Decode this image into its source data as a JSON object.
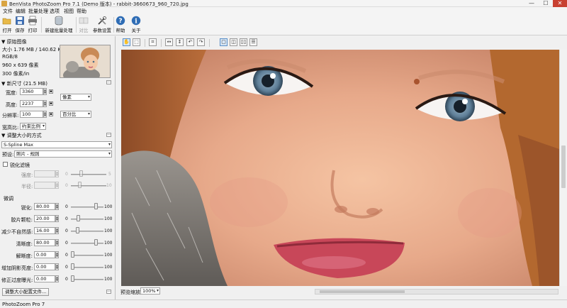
{
  "window": {
    "title": "BenVista PhotoZoom Pro 7.1 (Demo 版本) - rabbit-3660673_960_720.jpg",
    "minimize": "—",
    "maximize": "☐",
    "close": "✕"
  },
  "menu": [
    "文件",
    "编辑",
    "批量处理",
    "选项",
    "视图",
    "帮助"
  ],
  "toolbar": {
    "open": "打开",
    "save": "保存",
    "print": "打印",
    "batch": "新建批量处理",
    "batch_icon_label": "批量",
    "compare": "对比",
    "params": "参数设置",
    "help": "帮助",
    "about": "关于"
  },
  "original": {
    "section": "▼ 原始图像",
    "size": "大小 1.76 MB / 140.62 KB",
    "mode": "RGB/8",
    "dimensions": "960 x 639 像素",
    "resolution": "300 像素/in"
  },
  "new_size": {
    "section": "▼ 新尺寸 (21.5 MB)",
    "width_label": "宽度:",
    "width_value": "3360",
    "height_label": "高度:",
    "height_value": "2237",
    "resolution_label": "分辨率:",
    "resolution_value": "100",
    "unit": "像素",
    "res_unit": "百分比",
    "aspect_label": "宽高比:",
    "aspect_value": "约束比例"
  },
  "resize_method": {
    "section": "▼ 调整大小的方式",
    "method": "S-Spline Max",
    "preset_label": "预设:",
    "preset_value": "照片 - 规则"
  },
  "sharpen_filter": {
    "checkbox_label": "锐化滤镜",
    "strength_label": "强度:",
    "radius_label": "半径:",
    "min": "0",
    "strength_max": "5",
    "radius_max": "10"
  },
  "fine_tune": {
    "title": "微调",
    "min": "0",
    "max": "100",
    "rows": [
      {
        "label": "锐化:",
        "value": "80.00",
        "level": 0.8
      },
      {
        "label": "胶片颗粒:",
        "value": "20.00",
        "level": 0.2
      },
      {
        "label": "减少不自然感:",
        "value": "16.00",
        "level": 0.16
      },
      {
        "label": "清晰度:",
        "value": "80.00",
        "level": 0.8
      },
      {
        "label": "解晰度:",
        "value": "0.00",
        "level": 0.0
      },
      {
        "label": "增加阴影亮度:",
        "value": "0.00",
        "level": 0.0
      },
      {
        "label": "修正过度曝光:",
        "value": "0.00",
        "level": 0.0
      }
    ]
  },
  "resize_profile_button": "调整大小配置文件...",
  "preview": {
    "zoom_label": "预览缩放:",
    "zoom_value": "100%"
  },
  "status": {
    "text": "PhotoZoom Pro 7"
  },
  "colors": {
    "accent_blue": "#2f6db5",
    "close_red": "#c84031",
    "panel_bg": "#f0f0f0"
  }
}
